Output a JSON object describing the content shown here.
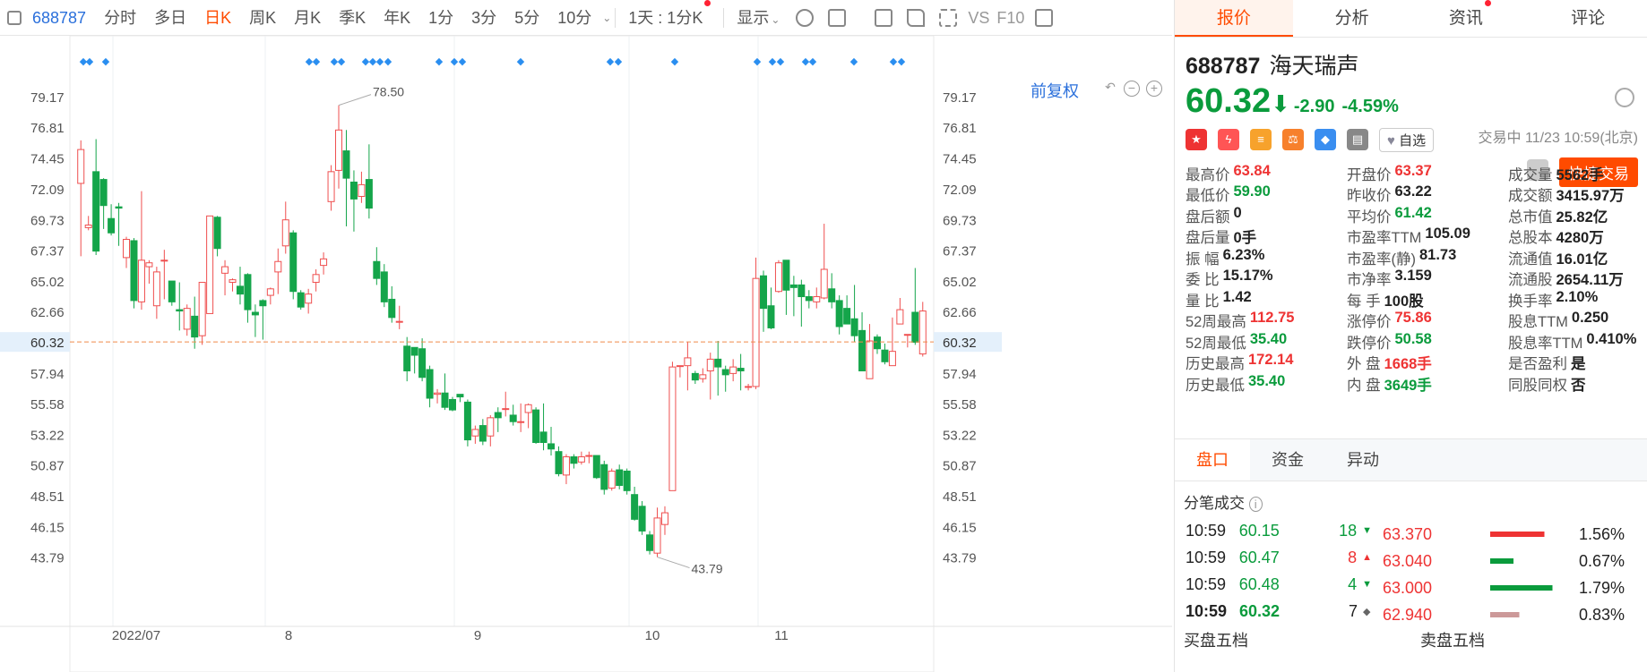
{
  "toolbar": {
    "symbol": "688787",
    "periods": [
      "分时",
      "多日",
      "日K",
      "周K",
      "月K",
      "季K",
      "年K",
      "1分",
      "3分",
      "5分",
      "10分"
    ],
    "active_period": "日K",
    "interval_label": "1天 : 1分K",
    "display_label": "显示",
    "vs_label": "VS",
    "f10_label": "F10"
  },
  "chart": {
    "adjust_label": "前复权",
    "current_price_label": "60.32",
    "high_marker": "78.50",
    "low_marker": "43.79",
    "y_ticks": [
      "79.17",
      "76.81",
      "74.45",
      "72.09",
      "69.73",
      "67.37",
      "65.02",
      "62.66",
      "60.32",
      "57.94",
      "55.58",
      "53.22",
      "50.87",
      "48.51",
      "46.15",
      "43.79"
    ],
    "x_labels": [
      "2022/07",
      "8",
      "9",
      "10",
      "11"
    ]
  },
  "chart_data": {
    "type": "candlestick",
    "ylim": [
      42.6,
      80.4
    ],
    "y_ticks": [
      79.17,
      76.81,
      74.45,
      72.09,
      69.73,
      67.37,
      65.02,
      62.66,
      60.32,
      57.94,
      55.58,
      53.22,
      50.87,
      48.51,
      46.15,
      43.79
    ],
    "x_labels": [
      "2022/07",
      "8",
      "9",
      "10",
      "11"
    ],
    "last_price": 60.32,
    "candles": [
      [
        72.5,
        75.1,
        66.9,
        75.8
      ],
      [
        69.1,
        69.3,
        68.9,
        70.0
      ],
      [
        73.4,
        67.3,
        67.0,
        75.9
      ],
      [
        72.8,
        70.8,
        69.0,
        72.9
      ],
      [
        69.8,
        68.7,
        68.5,
        70.9
      ],
      [
        70.7,
        70.6,
        67.7,
        71.0
      ],
      [
        66.8,
        68.2,
        66.0,
        68.4
      ],
      [
        68.1,
        63.5,
        62.9,
        68.3
      ],
      [
        63.4,
        66.6,
        62.8,
        71.9
      ],
      [
        66.1,
        66.4,
        64.8,
        66.6
      ],
      [
        63.1,
        65.7,
        62.1,
        66.1
      ],
      [
        66.6,
        66.6,
        63.6,
        67.4
      ],
      [
        65.0,
        63.4,
        63.1,
        65.0
      ],
      [
        62.8,
        62.7,
        61.2,
        64.9
      ],
      [
        61.3,
        62.9,
        60.8,
        63.2
      ],
      [
        62.3,
        60.7,
        59.8,
        63.8
      ],
      [
        60.8,
        64.9,
        60.1,
        64.9
      ],
      [
        62.5,
        70.0,
        62.5,
        70.0
      ],
      [
        69.9,
        67.5,
        66.9,
        70.0
      ],
      [
        65.6,
        66.1,
        63.9,
        66.6
      ],
      [
        64.9,
        65.1,
        64.2,
        65.2
      ],
      [
        64.6,
        64.0,
        63.2,
        66.1
      ],
      [
        65.5,
        62.8,
        61.8,
        65.6
      ],
      [
        62.6,
        62.4,
        60.7,
        63.2
      ],
      [
        63.5,
        63.1,
        60.5,
        63.6
      ],
      [
        63.9,
        64.4,
        63.2,
        64.5
      ],
      [
        65.7,
        66.5,
        64.0,
        67.5
      ],
      [
        67.7,
        69.7,
        67.1,
        71.1
      ],
      [
        68.7,
        64.2,
        63.6,
        68.9
      ],
      [
        64.1,
        63.0,
        62.8,
        64.3
      ],
      [
        63.3,
        64.0,
        62.5,
        64.4
      ],
      [
        64.9,
        65.5,
        64.2,
        65.9
      ],
      [
        66.2,
        66.7,
        65.5,
        67.2
      ],
      [
        71.1,
        73.4,
        70.4,
        73.9
      ],
      [
        73.5,
        76.6,
        72.1,
        78.5
      ],
      [
        75.0,
        72.9,
        69.2,
        76.6
      ],
      [
        72.6,
        71.3,
        68.8,
        73.5
      ],
      [
        71.5,
        72.4,
        71.0,
        73.4
      ],
      [
        72.8,
        70.6,
        69.8,
        75.5
      ],
      [
        66.5,
        65.2,
        64.7,
        67.6
      ],
      [
        65.7,
        63.4,
        63.0,
        66.3
      ],
      [
        63.6,
        62.2,
        61.8,
        64.6
      ],
      [
        61.9,
        61.9,
        61.3,
        63.1
      ],
      [
        60.0,
        58.1,
        57.3,
        60.7
      ],
      [
        59.9,
        59.3,
        57.9,
        59.9
      ],
      [
        59.8,
        57.6,
        57.3,
        60.6
      ],
      [
        58.2,
        56.0,
        55.3,
        58.5
      ],
      [
        56.3,
        56.4,
        55.6,
        56.7
      ],
      [
        56.4,
        55.3,
        55.1,
        57.9
      ],
      [
        55.9,
        55.1,
        55.0,
        56.1
      ],
      [
        56.3,
        56.1,
        55.7,
        56.3
      ],
      [
        55.7,
        52.8,
        52.3,
        55.9
      ],
      [
        53.1,
        53.6,
        52.5,
        53.9
      ],
      [
        53.9,
        52.7,
        52.4,
        54.4
      ],
      [
        53.1,
        54.5,
        52.3,
        54.7
      ],
      [
        54.9,
        54.5,
        53.4,
        55.3
      ],
      [
        55.2,
        55.2,
        54.6,
        56.5
      ],
      [
        54.7,
        54.2,
        53.9,
        55.5
      ],
      [
        54.2,
        54.2,
        53.4,
        55.6
      ],
      [
        54.9,
        55.5,
        53.7,
        55.6
      ],
      [
        55.1,
        52.6,
        52.5,
        55.3
      ],
      [
        53.4,
        52.6,
        52.0,
        55.6
      ],
      [
        52.5,
        52.1,
        51.6,
        53.8
      ],
      [
        51.9,
        50.2,
        50.0,
        52.3
      ],
      [
        50.1,
        51.5,
        49.4,
        51.7
      ],
      [
        51.5,
        51.0,
        50.6,
        51.7
      ],
      [
        51.1,
        51.5,
        50.9,
        51.9
      ],
      [
        51.6,
        51.6,
        51.0,
        51.9
      ],
      [
        51.6,
        49.9,
        49.8,
        51.6
      ],
      [
        50.9,
        49.0,
        48.6,
        51.2
      ],
      [
        49.1,
        50.4,
        48.9,
        50.6
      ],
      [
        50.5,
        49.3,
        49.0,
        50.9
      ],
      [
        50.4,
        48.9,
        48.6,
        50.6
      ],
      [
        48.6,
        46.7,
        46.6,
        49.2
      ],
      [
        47.7,
        45.8,
        45.5,
        48.1
      ],
      [
        45.5,
        44.3,
        44.0,
        45.8
      ],
      [
        44.1,
        46.8,
        43.8,
        47.6
      ],
      [
        46.3,
        47.2,
        45.5,
        47.7
      ],
      [
        48.9,
        58.4,
        48.9,
        58.8
      ],
      [
        58.5,
        58.5,
        57.6,
        58.5
      ],
      [
        58.5,
        59.1,
        56.6,
        60.3
      ],
      [
        57.9,
        57.4,
        57.1,
        58.1
      ],
      [
        57.5,
        57.8,
        57.2,
        58.3
      ],
      [
        58.1,
        59.0,
        55.9,
        59.5
      ],
      [
        59.0,
        58.4,
        56.2,
        60.4
      ],
      [
        58.2,
        57.8,
        56.5,
        58.5
      ],
      [
        57.9,
        58.4,
        57.3,
        59.0
      ],
      [
        58.3,
        58.1,
        56.6,
        59.4
      ],
      [
        56.9,
        56.9,
        56.6,
        57.1
      ],
      [
        56.9,
        65.2,
        56.7,
        66.8
      ],
      [
        65.4,
        62.9,
        61.1,
        65.8
      ],
      [
        63.1,
        61.4,
        61.3,
        64.5
      ],
      [
        64.2,
        66.4,
        64.1,
        66.6
      ],
      [
        66.6,
        64.3,
        62.4,
        66.6
      ],
      [
        64.7,
        64.5,
        62.3,
        65.4
      ],
      [
        64.7,
        63.8,
        61.5,
        65.1
      ],
      [
        63.8,
        63.5,
        62.9,
        64.3
      ],
      [
        63.4,
        63.8,
        62.9,
        64.5
      ],
      [
        63.7,
        65.9,
        63.6,
        69.4
      ],
      [
        64.4,
        63.4,
        62.9,
        65.6
      ],
      [
        63.5,
        61.5,
        60.9,
        63.9
      ],
      [
        62.9,
        61.7,
        61.7,
        63.9
      ],
      [
        62.1,
        60.8,
        60.3,
        64.7
      ],
      [
        61.2,
        58.1,
        58.1,
        62.6
      ],
      [
        57.5,
        60.4,
        57.6,
        61.7
      ],
      [
        60.7,
        59.8,
        59.4,
        60.9
      ],
      [
        59.7,
        58.8,
        58.6,
        60.2
      ],
      [
        58.5,
        59.6,
        58.6,
        62.2
      ],
      [
        61.7,
        62.8,
        61.8,
        63.7
      ],
      [
        60.9,
        60.9,
        59.9,
        60.9
      ],
      [
        62.6,
        60.3,
        60.1,
        66.0
      ],
      [
        59.4,
        62.7,
        59.2,
        63.4
      ]
    ]
  },
  "panel": {
    "tabs": [
      "报价",
      "分析",
      "资讯",
      "评论"
    ],
    "active_tab": "报价",
    "code": "688787",
    "name": "海天瑞声",
    "price": "60.32",
    "change": "-2.90",
    "change_pct": "-4.59%",
    "status": "交易中 11/23 10:59(北京)",
    "watch_label": "自选",
    "quick_trade_label": "快捷交易",
    "stats": [
      [
        {
          "l": "最高价",
          "v": "63.84",
          "c": "red"
        },
        {
          "l": "开盘价",
          "v": "63.37",
          "c": "red"
        },
        {
          "l": "成交量",
          "v": "5562手",
          "c": ""
        }
      ],
      [
        {
          "l": "最低价",
          "v": "59.90",
          "c": "green"
        },
        {
          "l": "昨收价",
          "v": "63.22",
          "c": ""
        },
        {
          "l": "成交额",
          "v": "3415.97万",
          "c": ""
        }
      ],
      [
        {
          "l": "盘后额",
          "v": "0",
          "c": ""
        },
        {
          "l": "平均价",
          "v": "61.42",
          "c": "green"
        },
        {
          "l": "总市值",
          "v": "25.82亿",
          "c": ""
        }
      ],
      [
        {
          "l": "盘后量",
          "v": "0手",
          "c": ""
        },
        {
          "l": "市盈率TTM",
          "v": "105.09",
          "c": ""
        },
        {
          "l": "总股本",
          "v": "4280万",
          "c": ""
        }
      ],
      [
        {
          "l": "振  幅",
          "v": "6.23%",
          "c": ""
        },
        {
          "l": "市盈率(静)",
          "v": "81.73",
          "c": ""
        },
        {
          "l": "流通值",
          "v": "16.01亿",
          "c": ""
        }
      ],
      [
        {
          "l": "委  比",
          "v": "15.17%",
          "c": ""
        },
        {
          "l": "市净率",
          "v": "3.159",
          "c": ""
        },
        {
          "l": "流通股",
          "v": "2654.11万",
          "c": ""
        }
      ],
      [
        {
          "l": "量  比",
          "v": "1.42",
          "c": ""
        },
        {
          "l": "每  手",
          "v": "100股",
          "c": ""
        },
        {
          "l": "换手率",
          "v": "2.10%",
          "c": ""
        }
      ],
      [
        {
          "l": "52周最高",
          "v": "112.75",
          "c": "red"
        },
        {
          "l": "涨停价",
          "v": "75.86",
          "c": "red"
        },
        {
          "l": "股息TTM",
          "v": "0.250",
          "c": ""
        }
      ],
      [
        {
          "l": "52周最低",
          "v": "35.40",
          "c": "green"
        },
        {
          "l": "跌停价",
          "v": "50.58",
          "c": "green"
        },
        {
          "l": "股息率TTM",
          "v": "0.410%",
          "c": ""
        }
      ],
      [
        {
          "l": "历史最高",
          "v": "172.14",
          "c": "red"
        },
        {
          "l": "外  盘",
          "v": "1668手",
          "c": "red"
        },
        {
          "l": "是否盈利",
          "v": "是",
          "c": ""
        }
      ],
      [
        {
          "l": "历史最低",
          "v": "35.40",
          "c": "green"
        },
        {
          "l": "内  盘",
          "v": "3649手",
          "c": "green"
        },
        {
          "l": "同股同权",
          "v": "否",
          "c": ""
        }
      ]
    ],
    "sub_tabs": [
      "盘口",
      "资金",
      "异动"
    ],
    "ticks_title": "分笔成交",
    "trades": [
      {
        "time": "10:59",
        "price": "60.15",
        "vol": "18",
        "dir": "down"
      },
      {
        "time": "10:59",
        "price": "60.47",
        "vol": "8",
        "dir": "up"
      },
      {
        "time": "10:59",
        "price": "60.48",
        "vol": "4",
        "dir": "down"
      },
      {
        "time": "10:59",
        "price": "60.32",
        "vol": "7",
        "dir": "flat"
      }
    ],
    "levels": [
      {
        "price": "63.370",
        "pct": "1.56%",
        "color": "#e33"
      },
      {
        "price": "63.040",
        "pct": "0.67%",
        "color": "#0a9b3c"
      },
      {
        "price": "63.000",
        "pct": "1.79%",
        "color": "#0a9b3c"
      },
      {
        "price": "62.940",
        "pct": "0.83%",
        "color": "#c99"
      }
    ],
    "buy_book": "买盘五档",
    "sell_book": "卖盘五档"
  }
}
